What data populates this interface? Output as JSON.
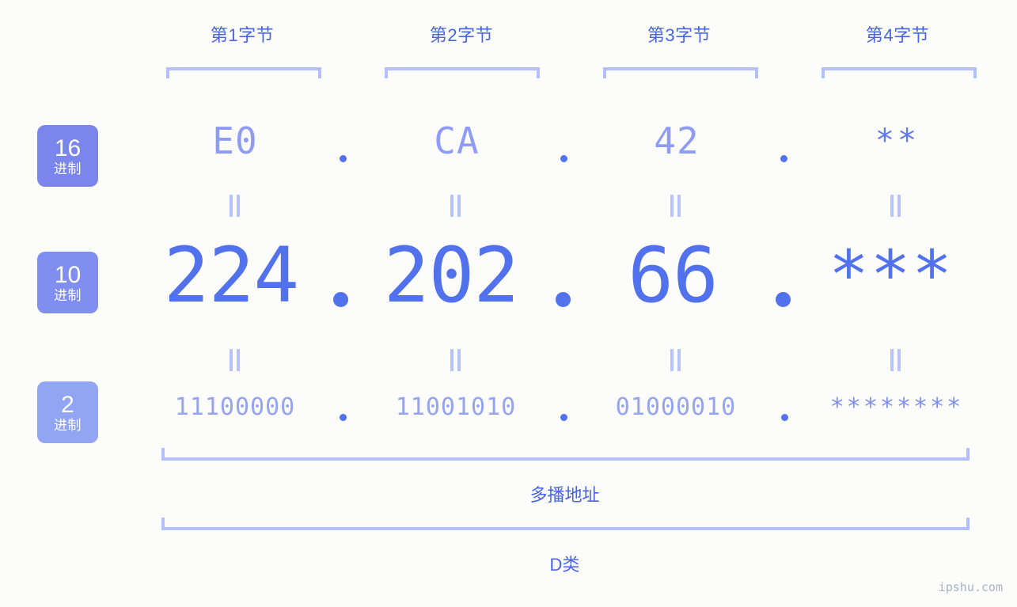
{
  "background_color": "#fcfdfa",
  "accent_color": "#4763e8",
  "palette": {
    "strong_blue": "#5271ed",
    "mid_blue": "#7b86ed",
    "light_blue": "#92a5f2",
    "pale_blue": "#b4c0fb",
    "hex_text": "#8e9cf4",
    "binary_text": "#95a3f3"
  },
  "byte_headers": [
    {
      "label": "第1字节"
    },
    {
      "label": "第2字节"
    },
    {
      "label": "第3字节"
    },
    {
      "label": "第4字节"
    }
  ],
  "radix_badges": [
    {
      "number": "16",
      "sub": "进制",
      "color": "#7b86ed"
    },
    {
      "number": "10",
      "sub": "进制",
      "color": "#808ef0"
    },
    {
      "number": "2",
      "sub": "进制",
      "color": "#92a5f2"
    }
  ],
  "rows": {
    "hex": {
      "radix": "16",
      "values": [
        "E0",
        "CA",
        "42",
        "**"
      ],
      "masked": [
        false,
        false,
        false,
        true
      ]
    },
    "decimal": {
      "radix": "10",
      "values": [
        "224",
        "202",
        "66",
        "***"
      ],
      "masked": [
        false,
        false,
        false,
        true
      ]
    },
    "binary": {
      "radix": "2",
      "values": [
        "11100000",
        "11001010",
        "01000010",
        "********"
      ],
      "masked": [
        false,
        false,
        false,
        true
      ]
    }
  },
  "separator": ".",
  "equals_symbol": "=",
  "captions": {
    "multicast": "多播地址",
    "class": "D类"
  },
  "watermark": "ipshu.com"
}
